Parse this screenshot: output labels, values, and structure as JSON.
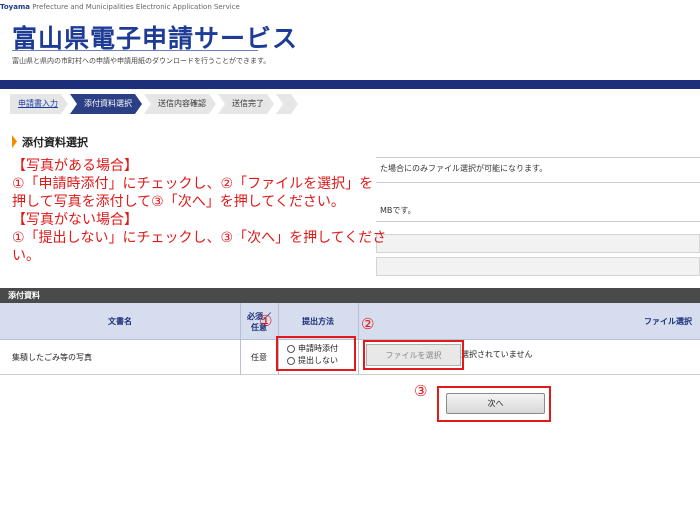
{
  "header": {
    "tagline_brand": "Toyama",
    "tagline_rest": " Prefecture and Municipalities Electronic Application Service",
    "site_title": "富山県電子申請サービス",
    "description": "富山県と県内の市町村への申請や申請用紙のダウンロードを行うことができます。"
  },
  "steps": [
    {
      "label": "申請書入力"
    },
    {
      "label": "添付資料選択"
    },
    {
      "label": "送信内容確認"
    },
    {
      "label": "送信完了"
    }
  ],
  "section_title": "添付資料選択",
  "background_notes": {
    "note1": "た場合にのみファイル選択が可能になります。",
    "note2": "MBです。"
  },
  "instructions": [
    "【写真がある場合】",
    "①「申請時添付」にチェックし、②「ファイルを選択」を",
    "押して写真を添付して③「次へ」を押してください。",
    "【写真がない場合】",
    "①「提出しない」にチェックし、③「次へ」を押してくださ",
    "い。"
  ],
  "table": {
    "caption": "添付資料",
    "headers": {
      "doc_name": "文書名",
      "required_line1": "必須／",
      "required_line2": "任意",
      "method": "提出方法",
      "file_select": "ファイル選択"
    },
    "rows": [
      {
        "doc_name": "集積したごみ等の写真",
        "required": "任意",
        "option_attach": "申請時添付",
        "option_none": "提出しない",
        "file_button": "ファイルを選択",
        "file_status": "選択されていません"
      }
    ]
  },
  "next_button": "次へ",
  "markers": {
    "m1": "①",
    "m2": "②",
    "m3": "③"
  },
  "colors": {
    "brand_blue": "#1e3c96",
    "header_bar": "#1c2f78",
    "highlight_red": "#e01a1a",
    "accent_orange": "#f08c00"
  }
}
